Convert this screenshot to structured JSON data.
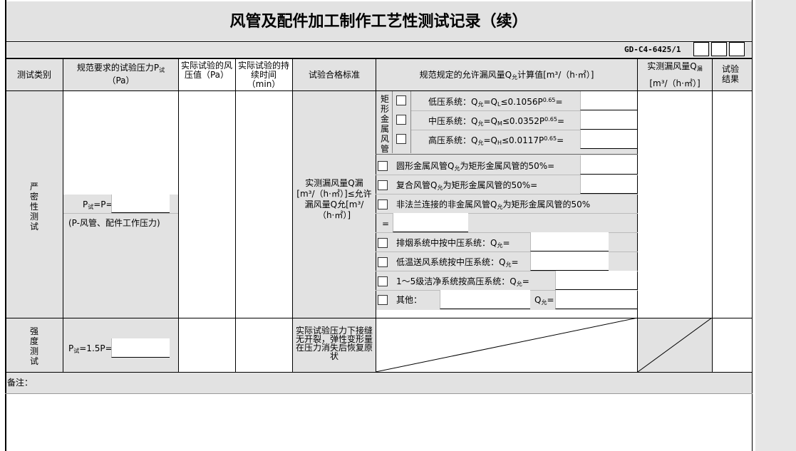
{
  "title": "风管及配件加工制作工艺性测试记录（续）",
  "code": "GD-C4-6425/1",
  "headers": {
    "col_category": "测试类别",
    "col_pressure_req": "规范要求的试验压力P",
    "col_pressure_req_sub": "试",
    "col_pressure_unit": "（Pa）",
    "col_actual_pressure": "实际试验的风压值（Pa）",
    "col_duration": "实际试验的持续时间（min）",
    "col_standard": "试验合格标准",
    "col_allowed_leak": "规范规定的允许漏风量Q",
    "col_allowed_leak_sub": "允",
    "col_allowed_leak_tail": "计算值[m³/（h·㎡）]",
    "col_actual_leak": "实测漏风量Q",
    "col_actual_leak_sub": "漏",
    "col_actual_leak_unit": "[m³/（h·㎡）]",
    "col_result": "试验结果"
  },
  "tightness": {
    "label": "严密性测试",
    "pressure_formula": "=P=",
    "pressure_formula_prefix": "P",
    "pressure_formula_sub": "试",
    "pressure_note": "(P-风管、配件工作压力)",
    "standard_text": "实测漏风量Q漏[m³/（h·㎡）]≤允许漏风量Q允[m³/（h·㎡）]",
    "rect_label": "矩形金属风管",
    "rect_rows": [
      {
        "prefix": "低压系统：Q",
        "sub1": "允",
        "mid": "=Q",
        "sub2": "L",
        "tail": "≤0.1056P",
        "exp": "0.65",
        "end": "="
      },
      {
        "prefix": "中压系统：Q",
        "sub1": "允",
        "mid": "=Q",
        "sub2": "M",
        "tail": "≤0.0352P",
        "exp": "0.65",
        "end": "="
      },
      {
        "prefix": "高压系统：Q",
        "sub1": "允",
        "mid": "=Q",
        "sub2": "H",
        "tail": "≤0.0117P",
        "exp": "0.65",
        "end": "="
      }
    ],
    "round_duct": {
      "a": "圆形金属风管Q",
      "sub": "允",
      "b": "为矩形金属风管的50%="
    },
    "composite_duct": {
      "a": "复合风管Q",
      "sub": "允",
      "b": "为矩形金属风管的50%="
    },
    "nonmetal_duct": {
      "a": "非法兰连接的非金属风管Q",
      "sub": "允",
      "b": "为矩形金属风管的50%"
    },
    "equals": "=",
    "smoke": {
      "a": "排烟系统中按中压系统：Q",
      "sub": "允",
      "b": "="
    },
    "lowtemp": {
      "a": "低温送风系统按中压系统：Q",
      "sub": "允",
      "b": "="
    },
    "clean": {
      "a": "1～5级洁净系统按高压系统：Q",
      "sub": "允",
      "b": "="
    },
    "other": {
      "a": "其他：",
      "q": "Q",
      "sub": "允",
      "b": "="
    }
  },
  "strength": {
    "label": "强度测试",
    "pressure_prefix": "P",
    "pressure_sub": "试",
    "pressure_formula": "=1.5P=",
    "standard_text": "实际试验压力下接缝无开裂，弹性变形量在压力消失后恢复原状"
  },
  "remarks_label": "备注："
}
